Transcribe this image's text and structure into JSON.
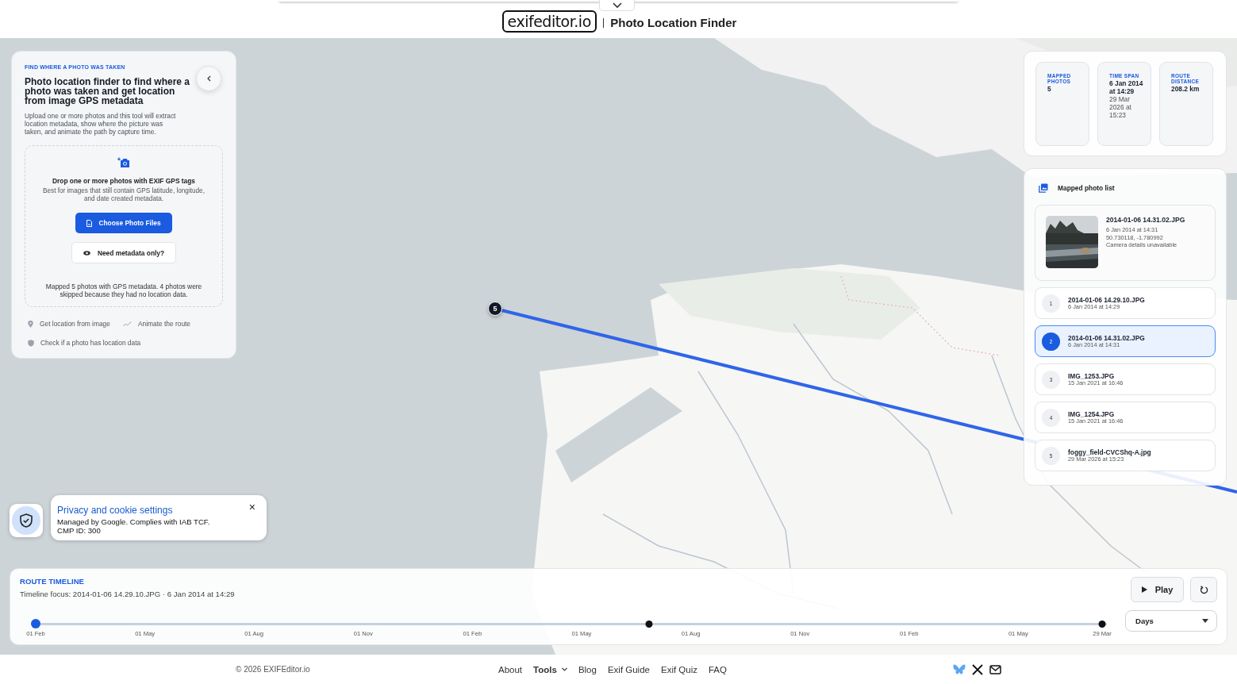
{
  "header": {
    "logo": "exifeditor.io",
    "title": "Photo Location Finder"
  },
  "intro_panel": {
    "eyebrow": "FIND WHERE A PHOTO WAS TAKEN",
    "heading": "Photo location finder to find where a photo was taken and get location from image GPS metadata",
    "description": "Upload one or more photos and this tool will extract location metadata, show where the picture was taken, and animate the path by capture time.",
    "dropzone": {
      "title": "Drop one or more photos with EXIF GPS tags",
      "hint": "Best for images that still contain GPS latitude, longitude, and date created metadata.",
      "primary_button": "Choose Photo Files",
      "secondary_button": "Need metadata only?",
      "status": "Mapped 5 photos with GPS metadata. 4 photos were skipped because they had no location data."
    },
    "links": [
      {
        "kind": "pin",
        "label": "Get location from image"
      },
      {
        "kind": "route",
        "label": "Animate the route"
      },
      {
        "kind": "shield",
        "label": "Check if a photo has location data"
      }
    ]
  },
  "map": {
    "kind": "picture",
    "marker_label": "5"
  },
  "stats": [
    {
      "label": "MAPPED PHOTOS",
      "value": "5"
    },
    {
      "label": "TIME SPAN",
      "value": "6 Jan 2014 at 14:29",
      "secondary": "29 Mar 2026 at 15:23"
    },
    {
      "label": "ROUTE DISTANCE",
      "value": "208.2 km"
    }
  ],
  "photo_list": {
    "title": "Mapped photo list",
    "preview": {
      "name": "2014-01-06 14.31.02.JPG",
      "date": "6 Jan 2014 at 14:31",
      "coordinates": "50.730118, -1.780992",
      "camera": "Camera details unavailable"
    },
    "items": [
      {
        "number": "1",
        "name": "2014-01-06 14.29.10.JPG",
        "date": "6 Jan 2014 at 14:29",
        "selected": false
      },
      {
        "number": "2",
        "name": "2014-01-06 14.31.02.JPG",
        "date": "6 Jan 2014 at 14:31",
        "selected": true
      },
      {
        "number": "3",
        "name": "IMG_1253.JPG",
        "date": "15 Jan 2021 at 16:46",
        "selected": false
      },
      {
        "number": "4",
        "name": "IMG_1254.JPG",
        "date": "15 Jan 2021 at 16:46",
        "selected": false
      },
      {
        "number": "5",
        "name": "foggy_field-CVCShq-A.jpg",
        "date": "29 Mar 2026 at 15:23",
        "selected": false
      }
    ]
  },
  "cookie_notice": {
    "title": "Privacy and cookie settings",
    "text": "Managed by Google. Complies with IAB TCF.",
    "cmp": "CMP ID: 300",
    "close": "×"
  },
  "timeline": {
    "title": "ROUTE TIMELINE",
    "focus": "Timeline focus: 2014-01-06 14.29.10.JPG · 6 Jan 2014 at 14:29",
    "ticks": [
      "01 Feb",
      "01 May",
      "01 Aug",
      "01 Nov",
      "01 Feb",
      "01 May",
      "01 Aug",
      "01 Nov",
      "01 Feb",
      "01 May"
    ],
    "end_label": "29 Mar",
    "markers": [
      {
        "level": 0,
        "selected": true
      },
      {
        "level": 0.575,
        "selected": false
      },
      {
        "level": 1,
        "selected": false
      }
    ],
    "play_button": "Play",
    "interval": "Days"
  },
  "footer": {
    "copyright": "© 2026 EXIFEditor.io",
    "nav": [
      {
        "label": "About",
        "has_menu": false
      },
      {
        "label": "Tools",
        "has_menu": true
      },
      {
        "label": "Blog",
        "has_menu": false
      },
      {
        "label": "Exif Guide",
        "has_menu": false
      },
      {
        "label": "Exif Quiz",
        "has_menu": false
      },
      {
        "label": "FAQ",
        "has_menu": false
      }
    ]
  }
}
